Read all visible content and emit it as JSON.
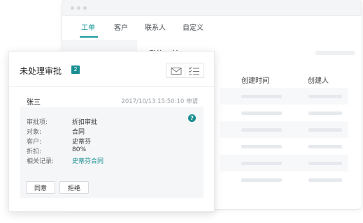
{
  "tabs": [
    {
      "label": "工单",
      "active": true
    },
    {
      "label": "客户",
      "active": false
    },
    {
      "label": "联系人",
      "active": false
    },
    {
      "label": "自定义",
      "active": false
    }
  ],
  "main": {
    "title": "我的工单",
    "columns": [
      "创建时间",
      "创建人"
    ]
  },
  "card": {
    "title": "未处理审批",
    "badge": "2",
    "actions": [
      "mail-icon",
      "checklist-icon"
    ]
  },
  "item": {
    "name": "张三",
    "time": "2017/10/13 15:50:10 申请",
    "help_icon": "?",
    "fields": [
      {
        "label": "审批项:",
        "value": "折扣审批"
      },
      {
        "label": "对象:",
        "value": "合同"
      },
      {
        "label": "客户:",
        "value": "史蒂芬"
      },
      {
        "label": "折扣:",
        "value": "80%"
      },
      {
        "label": "相关记录:",
        "value": "史蒂芬合同"
      }
    ],
    "buttons": {
      "agree": "同意",
      "reject": "拒绝"
    }
  },
  "colors": {
    "accent": "#1a8f92",
    "tab_active": "#1a9a9c"
  }
}
